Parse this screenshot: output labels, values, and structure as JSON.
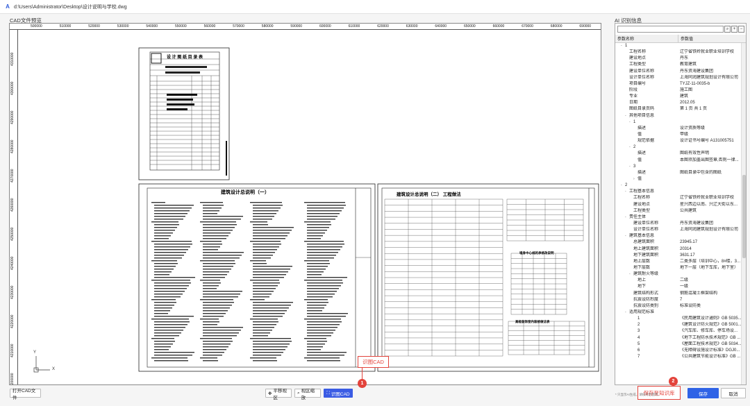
{
  "window": {
    "title": "d:\\Users\\Administrator\\Desktop\\设计说明与学校.dwg"
  },
  "cad": {
    "label": "CAD文件预览",
    "ruler_top": [
      "500000",
      "510000",
      "520000",
      "530000",
      "540000",
      "550000",
      "560000",
      "570000",
      "580000",
      "590000",
      "600000",
      "610000",
      "620000",
      "630000",
      "640000",
      "650000",
      "660000",
      "670000",
      "680000",
      "690000"
    ],
    "ruler_left": [
      "4310000",
      "4300000",
      "4290000",
      "4280000",
      "4270000",
      "4260000",
      "4250000",
      "4240000",
      "4230000",
      "4220000",
      "4210000",
      "4200000"
    ],
    "sheet1_title": "设 计 图 纸 目 录 表",
    "sheet2_title": "建筑设计总说明（一）",
    "sheet3_title": "建筑设计总说明（二）  工程做法",
    "table_caption_a": "墙身中心线的承修改说明",
    "table_caption_b": "高级装饰室内装修做法表",
    "axis_x": "X",
    "axis_y": "Y"
  },
  "toolbar": {
    "open_cad": "打开CAD文件",
    "pan": "平移视区",
    "zoom": "视区缩放",
    "identify": "识图CAD"
  },
  "annotations": {
    "callout1_label": "识图CAD",
    "callout1_num": "1",
    "callout2_label": "保存至知识库",
    "callout2_num": "2"
  },
  "ai": {
    "label": "AI 识别信息",
    "col_name": "参数名称",
    "col_value": "参数值",
    "search_placeholder": "",
    "rows": [
      {
        "n": "1",
        "v": "",
        "ind": 1,
        "tg": "-"
      },
      {
        "n": "工程名称",
        "v": "辽宁省铁岭就业职业培训学校",
        "ind": 2
      },
      {
        "n": "建设地点",
        "v": "丹东",
        "ind": 2
      },
      {
        "n": "工程类型",
        "v": "教育建筑",
        "ind": 2
      },
      {
        "n": "建设单位名称",
        "v": "丹东资海建设集团",
        "ind": 2
      },
      {
        "n": "设计单位名称",
        "v": "上海同润建筑规划设计有限公司",
        "ind": 2
      },
      {
        "n": "项目编号",
        "v": "TYJZ-11-0035-b",
        "ind": 2
      },
      {
        "n": "阶段",
        "v": "施工图",
        "ind": 2
      },
      {
        "n": "专业",
        "v": "建筑",
        "ind": 2
      },
      {
        "n": "日期",
        "v": "2012.05",
        "ind": 2
      },
      {
        "n": "图纸目录页码",
        "v": "第 1 页 共 1 页",
        "ind": 2
      },
      {
        "n": "其他项目信息",
        "v": "",
        "ind": 2,
        "tg": "-"
      },
      {
        "n": "1",
        "v": "",
        "ind": 3,
        "tg": "-"
      },
      {
        "n": "描述",
        "v": "设计资质等级",
        "ind": 4
      },
      {
        "n": "值",
        "v": "甲级",
        "ind": 4
      },
      {
        "n": "规范依据",
        "v": "设计证书号编号 A131005751",
        "ind": 4
      },
      {
        "n": "2",
        "v": "",
        "ind": 3,
        "tg": "-"
      },
      {
        "n": "描述",
        "v": "图纸有效性声明",
        "ind": 4
      },
      {
        "n": "值",
        "v": "本图须加盖出图签章,否则一律...",
        "ind": 4
      },
      {
        "n": "3",
        "v": "",
        "ind": 3,
        "tg": "-"
      },
      {
        "n": "描述",
        "v": "图纸目录中包含的图纸",
        "ind": 4
      },
      {
        "n": "值",
        "v": "",
        "ind": 4,
        "tg": "›"
      },
      {
        "n": "2",
        "v": "",
        "ind": 1,
        "tg": "-"
      },
      {
        "n": "工程基本信息",
        "v": "",
        "ind": 2,
        "tg": "-"
      },
      {
        "n": "工程名称",
        "v": "辽宁省铁岭就业职业培训学校",
        "ind": 3
      },
      {
        "n": "建设地点",
        "v": "星兴西边以南、兴辽大街以东...",
        "ind": 3
      },
      {
        "n": "工程类型",
        "v": "公共建筑",
        "ind": 3
      },
      {
        "n": "责任主体",
        "v": "",
        "ind": 2,
        "tg": "-"
      },
      {
        "n": "建设单位名称",
        "v": "丹东资海建设集团",
        "ind": 3
      },
      {
        "n": "设计单位名称",
        "v": "上海同润建筑规划设计有限公司",
        "ind": 3
      },
      {
        "n": "建筑基本信息",
        "v": "",
        "ind": 2,
        "tg": "-"
      },
      {
        "n": "总建筑面积",
        "v": "23945.17",
        "ind": 3
      },
      {
        "n": "地上建筑面积",
        "v": "20314",
        "ind": 3
      },
      {
        "n": "地下建筑面积",
        "v": "3631.17",
        "ind": 3
      },
      {
        "n": "地上层数",
        "v": "二类多层（培训中心，8#楼，3...",
        "ind": 3
      },
      {
        "n": "地下层数",
        "v": "地下一层（地下车库，地下室）",
        "ind": 3
      },
      {
        "n": "建筑耐火等级",
        "v": "",
        "ind": 3,
        "tg": "-"
      },
      {
        "n": "地上",
        "v": "二级",
        "ind": 4
      },
      {
        "n": "地下",
        "v": "一级",
        "ind": 4
      },
      {
        "n": "建筑结构形式",
        "v": "钢筋混凝土框架结构",
        "ind": 3
      },
      {
        "n": "抗震设防烈度",
        "v": "7",
        "ind": 3
      },
      {
        "n": "抗震设防类别",
        "v": "标准设防类",
        "ind": 3
      },
      {
        "n": "适用规范标准",
        "v": "",
        "ind": 2,
        "tg": "-"
      },
      {
        "n": "1",
        "v": "《民用建筑设计通则》GB 5035...",
        "ind": 4
      },
      {
        "n": "2",
        "v": "《建筑设计防火规范》GB 5001...",
        "ind": 4
      },
      {
        "n": "3",
        "v": "《汽车库、修车库、停车场设...",
        "ind": 4
      },
      {
        "n": "4",
        "v": "《地下工程防水技术规范》GB ...",
        "ind": 4
      },
      {
        "n": "5",
        "v": "《屋面工程技术规范》GB 5034...",
        "ind": 4
      },
      {
        "n": "6",
        "v": "《无障碍设施设计标准》DGJ0...",
        "ind": 4
      },
      {
        "n": "7",
        "v": "《公共建筑节能设计标准》GB ...",
        "ind": 4
      }
    ],
    "save": "保存",
    "cancel": "取消",
    "footnote": "* 只显示AI生成，请核对后使用。"
  }
}
